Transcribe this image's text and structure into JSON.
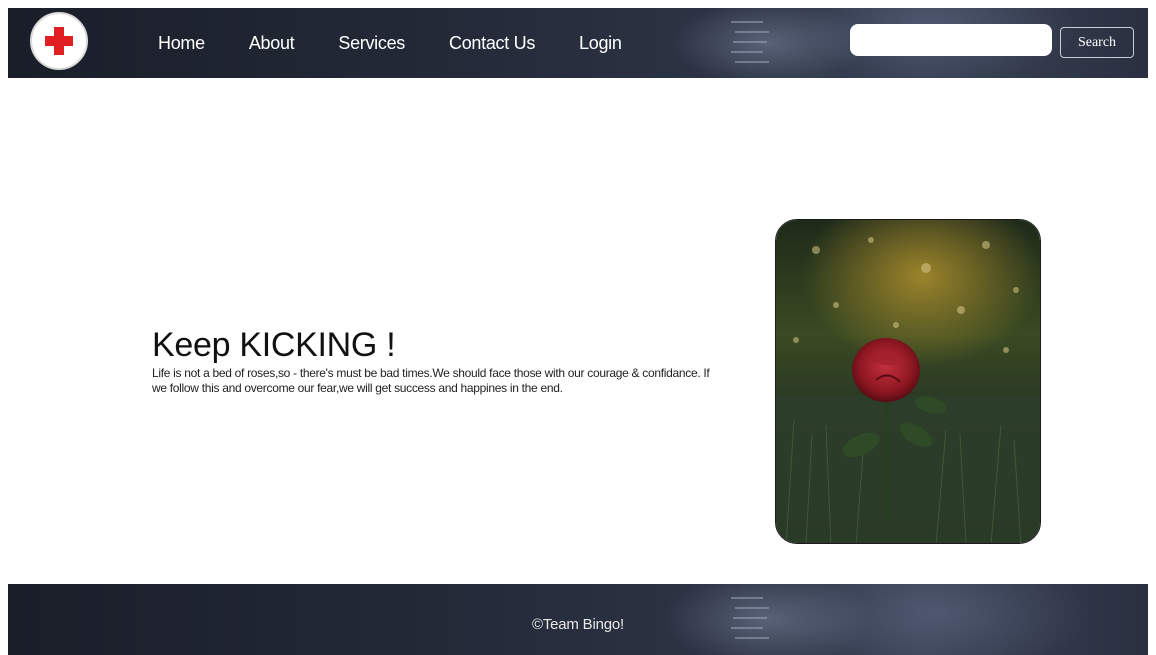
{
  "header": {
    "logo_icon": "red-cross-icon",
    "nav": [
      {
        "label": "Home"
      },
      {
        "label": "About"
      },
      {
        "label": "Services"
      },
      {
        "label": "Contact Us"
      },
      {
        "label": "Login"
      }
    ],
    "search": {
      "placeholder": "",
      "value": "",
      "button_label": "Search"
    }
  },
  "hero": {
    "title": "Keep KICKING !",
    "body": "Life is not a bed of roses,so - there's must be bad times.We should face those with our courage & confidance. If we follow this and overcome our fear,we will get success and happines in the end.",
    "image_icon": "rose-photo"
  },
  "footer": {
    "text": "©Team Bingo!"
  },
  "colors": {
    "header_bg": "#242a38",
    "logo_cross": "#e02020",
    "text_dark": "#111111"
  }
}
